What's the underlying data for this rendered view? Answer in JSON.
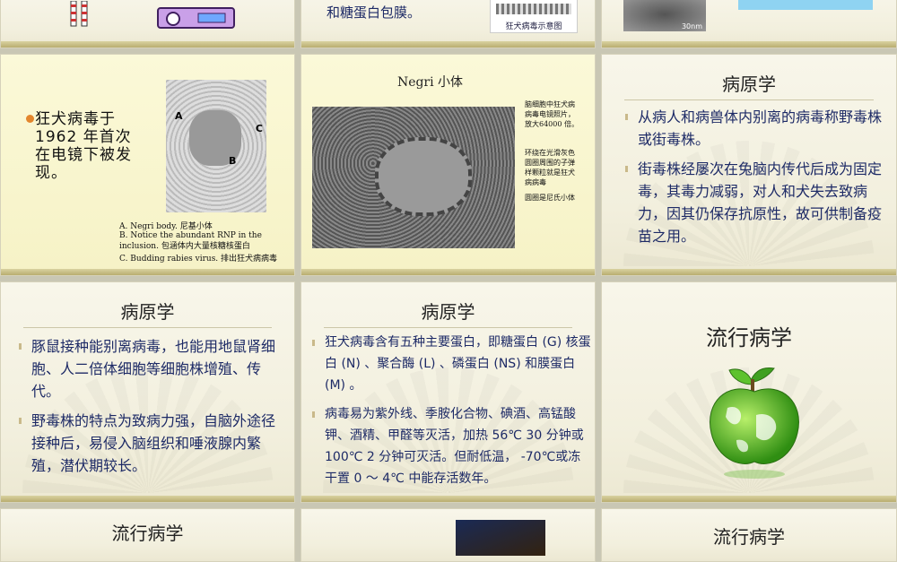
{
  "slides": {
    "top_middle": {
      "text": "和糖蛋白包膜。",
      "caption": "狂犬病毒示意图"
    },
    "top_right": {
      "scale": "30nm"
    },
    "s4": {
      "main": "狂犬病毒于1962 年首次在电镜下被发现。",
      "labels": {
        "a": "A",
        "b": "B",
        "c": "C"
      },
      "captions": [
        "A. Negri body. 尼基小体",
        "B. Notice the abundant RNP in the inclusion. 包涵体内大量核糖核蛋白",
        "C. Budding rabies virus. 排出狂犬病病毒"
      ]
    },
    "s5": {
      "title": "Negri 小体",
      "side_text": "脑细胞中狂犬病病毒电镜照片，放大64000 倍。",
      "side_text2": "环绕在光滑灰色圆圈周围的子弹样颗粒就是狂犬病病毒",
      "side_text3": "圆圈是尼氏小体"
    },
    "s6": {
      "title": "病原学",
      "bullets": [
        "从病人和病兽体内别离的病毒称野毒株或街毒株。",
        "街毒株经屡次在兔脑内传代后成为固定毒，其毒力减弱，对人和犬失去致病力，因其仍保存抗原性，故可供制备疫苗之用。"
      ]
    },
    "s7": {
      "title": "病原学",
      "bullets": [
        "豚鼠接种能别离病毒，也能用地鼠肾细胞、人二倍体细胞等细胞株增殖、传代。",
        "野毒株的特点为致病力强，自脑外途径接种后，易侵入脑组织和唾液腺内繁殖，潜伏期较长。"
      ]
    },
    "s8": {
      "title": "病原学",
      "bullets": [
        "狂犬病毒含有五种主要蛋白，即糖蛋白 (G) 核蛋白 (N) 、聚合酶 (L) 、磷蛋白 (NS) 和膜蛋白 (M) 。",
        "病毒易为紫外线、季胺化合物、碘酒、高锰酸钾、酒精、甲醛等灭活，加热 56℃ 30 分钟或 100℃ 2 分钟可灭活。但耐低温， -70℃或冻干置 0 ～ 4℃ 中能存活数年。"
      ]
    },
    "s9": {
      "title": "流行病学"
    },
    "s10": {
      "title": "流行病学"
    },
    "s12": {
      "title": "流行病学"
    }
  },
  "colors": {
    "bullet_text": "#1d2a66",
    "accent_bar": "#b9ad6f"
  },
  "icons": [
    "cartoon-legs-icon",
    "machine-icon",
    "virus-diagram-image",
    "micrograph-image",
    "apple-globe-icon"
  ]
}
